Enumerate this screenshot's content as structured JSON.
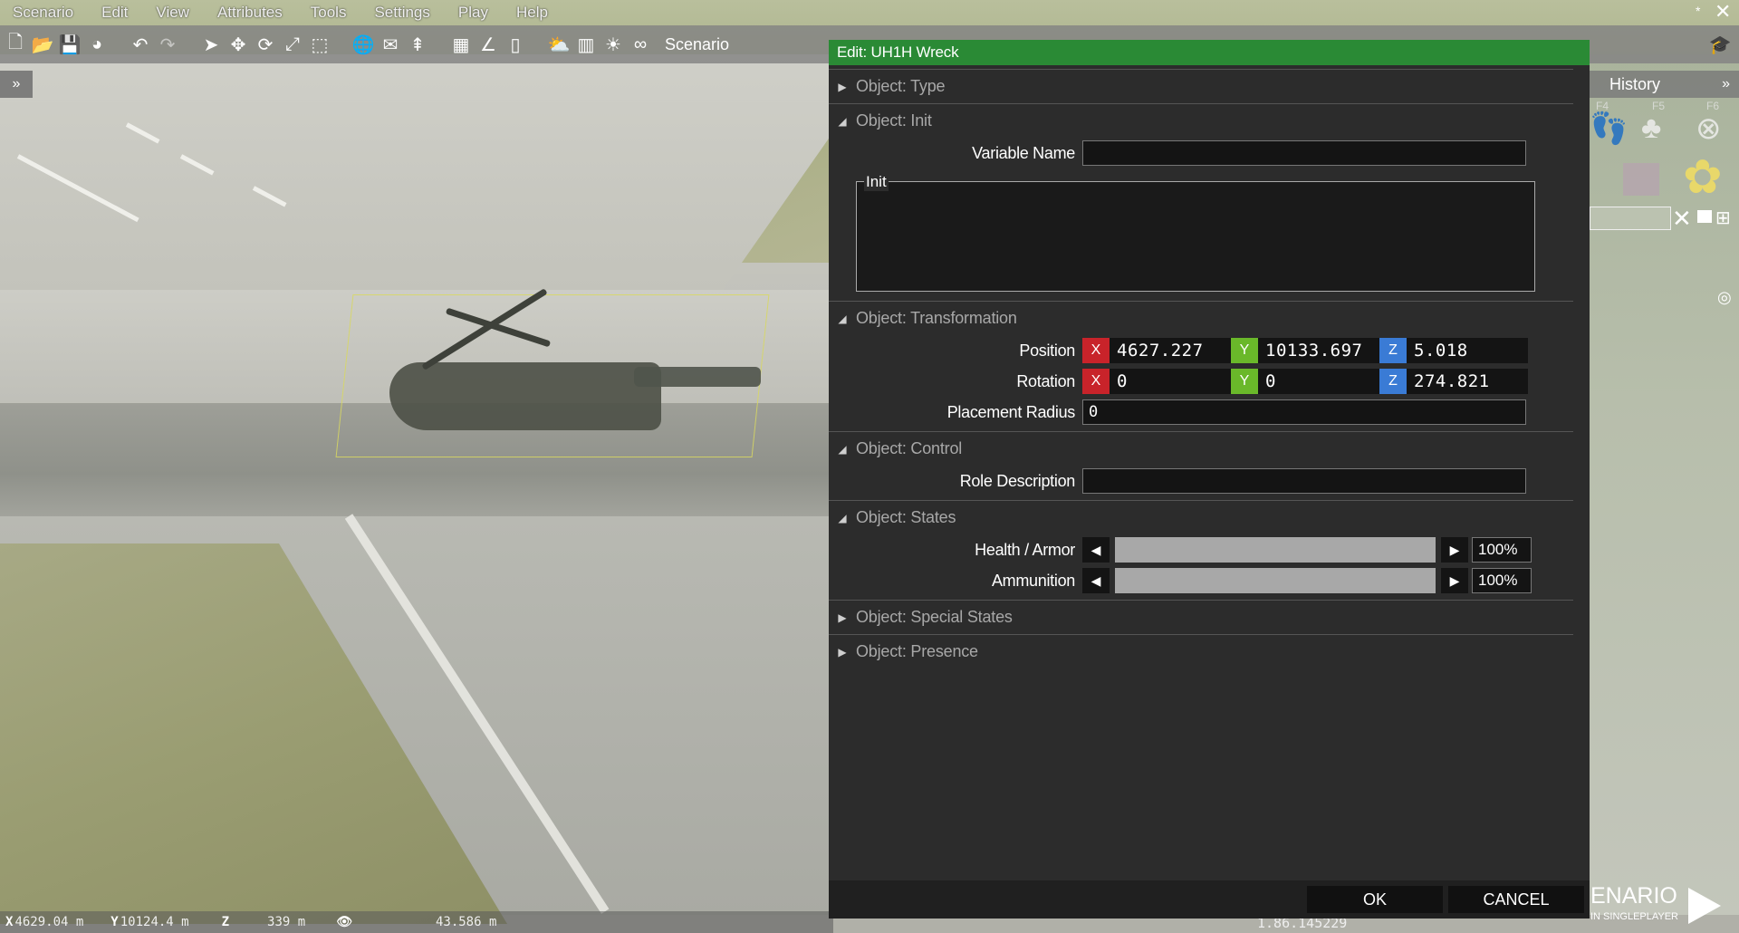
{
  "menu": [
    "Scenario",
    "Edit",
    "View",
    "Attributes",
    "Tools",
    "Settings",
    "Play",
    "Help"
  ],
  "window_controls": {
    "pin": "*",
    "close": "✕"
  },
  "toolbar": {
    "scenario_label": "Scenario"
  },
  "left_expand": "»",
  "history": {
    "title": "History",
    "expand": "»",
    "fkeys": [
      "F4",
      "F5",
      "F6"
    ]
  },
  "dialog": {
    "title": "Edit: UH1H Wreck",
    "sections": {
      "type": "Object: Type",
      "init": "Object: Init",
      "transformation": "Object: Transformation",
      "control": "Object: Control",
      "states": "Object: States",
      "special_states": "Object: Special States",
      "presence": "Object: Presence"
    },
    "init": {
      "variable_name_label": "Variable Name",
      "variable_name_value": "",
      "init_label": "Init",
      "init_value": ""
    },
    "transformation": {
      "position_label": "Position",
      "position": {
        "x": "4627.227",
        "y": "10133.697",
        "z": "5.018"
      },
      "rotation_label": "Rotation",
      "rotation": {
        "x": "0",
        "y": "0",
        "z": "274.821"
      },
      "axis_labels": {
        "x": "X",
        "y": "Y",
        "z": "Z"
      },
      "placement_radius_label": "Placement Radius",
      "placement_radius": "0"
    },
    "control": {
      "role_description_label": "Role Description",
      "role_description": ""
    },
    "states": {
      "health_label": "Health / Armor",
      "health_value": "100%",
      "health_fraction": 1.0,
      "ammo_label": "Ammunition",
      "ammo_value": "100%",
      "ammo_fraction": 1.0
    },
    "buttons": {
      "ok": "OK",
      "cancel": "CANCEL"
    }
  },
  "play": {
    "title": "ENARIO",
    "subtitle": "IN SINGLEPLAYER"
  },
  "status": {
    "x_label": "X",
    "x_value": "4629.04 m",
    "y_label": "Y",
    "y_value": "10124.4 m",
    "z_label": "Z",
    "z_value": "339 m",
    "view_value": "43.586 m",
    "time_value": "1.86.145229"
  },
  "colors": {
    "title_bar": "#2a8a35",
    "axis_x": "#c8232a",
    "axis_y": "#6ab82a",
    "axis_z": "#3a7bd5"
  }
}
